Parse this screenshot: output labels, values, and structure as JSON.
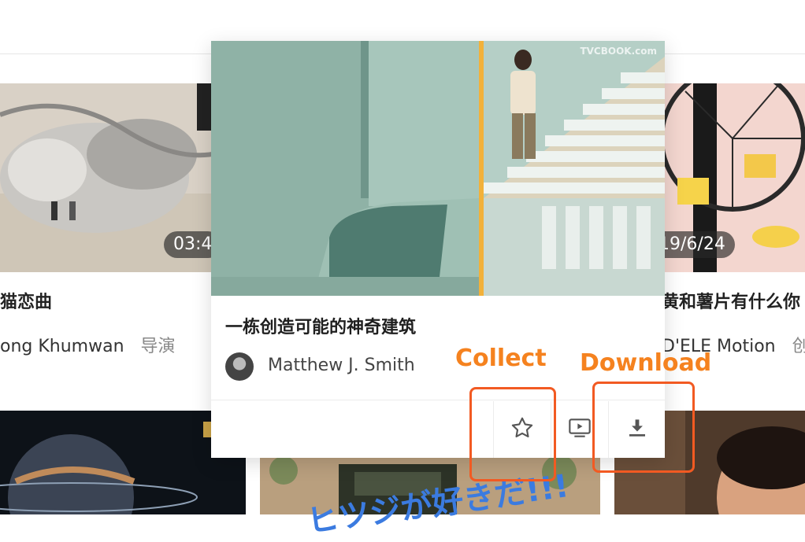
{
  "background_cards": [
    {
      "title": "猫恋曲",
      "author": "ong Khumwan",
      "role": "导演",
      "duration": "03:4"
    },
    {
      "title": "黄和薯片有什么你",
      "author": "D'ELE Motion",
      "role": "创",
      "date": "19/6/24"
    }
  ],
  "popup": {
    "title": "一栋创造可能的神奇建筑",
    "author": "Matthew J. Smith",
    "watermark": "TVCBOOK.com"
  },
  "annotations": {
    "collect": "Collect",
    "download": "Download"
  },
  "bottom_cards": [
    {
      "overlay_text": "ヒツジが好きだ!!!"
    }
  ],
  "colors": {
    "accent_orange": "#f5821f",
    "box_red": "#f25a22"
  }
}
